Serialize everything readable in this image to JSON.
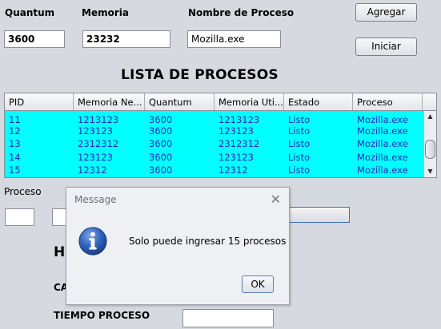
{
  "form": {
    "quantum_label": "Quantum",
    "quantum_value": "3600",
    "memoria_label": "Memoria",
    "memoria_value": "23232",
    "nombre_label": "Nombre de Proceso",
    "nombre_value": "Mozilla.exe",
    "agregar_button": "Agregar",
    "iniciar_button": "Iniciar"
  },
  "list_title": "LISTA DE PROCESOS",
  "table": {
    "columns": [
      "PID",
      "Memoria Ne...",
      "Quantum",
      "Memoria Uti...",
      "Estado",
      "Proceso"
    ],
    "rows": [
      [
        "11",
        "1213123",
        "3600",
        "1213123",
        "Listo",
        "Mozilla.exe"
      ],
      [
        "12",
        "123123",
        "3600",
        "123123",
        "Listo",
        "Mozilla.exe"
      ],
      [
        "13",
        "2312312",
        "3600",
        "2312312",
        "Listo",
        "Mozilla.exe"
      ],
      [
        "14",
        "123123",
        "3600",
        "123123",
        "Listo",
        "Mozilla.exe"
      ],
      [
        "15",
        "12312",
        "3600",
        "12312",
        "Listo",
        "Mozilla.exe"
      ]
    ],
    "row_background": "#00ffff",
    "row_text_color": "#2b2bb8"
  },
  "lower": {
    "proceso_label": "Proceso",
    "heading_fragment": "H",
    "ca_fragment": "CA",
    "tiempo_label": "TIEMPO PROCESO"
  },
  "dialog": {
    "title": "Message",
    "message": "Solo puede ingresar 15 procesos",
    "ok_button": "OK",
    "icon": "info-icon"
  }
}
